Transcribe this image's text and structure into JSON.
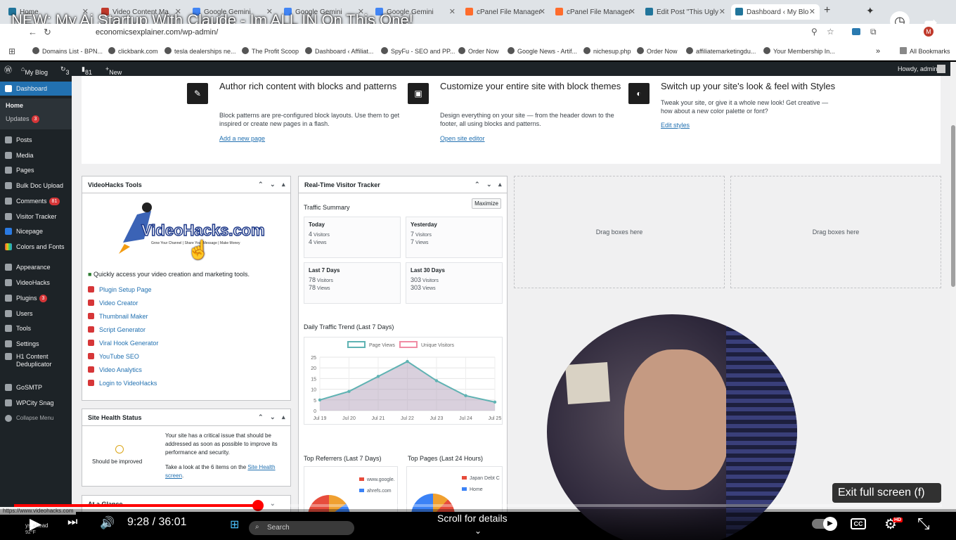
{
  "video": {
    "title": "NEW: My Ai Startup With Claude - Im ALL IN On This One!",
    "time_current": "9:28",
    "time_total": "36:01",
    "time_separator": " / ",
    "progress": 0.263,
    "scroll_hint": "Scroll for details",
    "exit_fullscreen": "Exit full screen (f)",
    "hd_badge": "HD",
    "cc_label": "CC",
    "ahead_text": "ys ahead",
    "temp_text": "92°F"
  },
  "browser": {
    "tabs": [
      "Home",
      "Video Content Ma",
      "Google Gemini",
      "Google Gemini",
      "Google Gemini",
      "cPanel File Manager",
      "cPanel File Manager",
      "Edit Post \"This Ugly",
      "Dashboard ‹ My Blo"
    ],
    "url": "economicsexplainer.com/wp-admin/",
    "bookmarks": [
      "Domains List - BPN...",
      "clickbank.com",
      "tesla dealerships ne...",
      "The Profit Scoop",
      "Dashboard ‹ Affiliat...",
      "SpyFu - SEO and PP...",
      "Order Now",
      "Google News - Artif...",
      "nichesup.php",
      "Order Now",
      "affiliatemarketingdu...",
      "Your Membership In..."
    ],
    "all_bookmarks": "All Bookmarks",
    "status_url": "https://www.videohacks.com"
  },
  "adminbar": {
    "site": "My Blog",
    "updates": "3",
    "comments": "81",
    "new": "New",
    "howdy": "Howdy, admin"
  },
  "sidebar": {
    "items": [
      {
        "label": "Dashboard"
      },
      {
        "label": "Home"
      },
      {
        "label": "Updates",
        "badge": "3"
      },
      {
        "label": "Posts"
      },
      {
        "label": "Media"
      },
      {
        "label": "Pages"
      },
      {
        "label": "Bulk Doc Upload"
      },
      {
        "label": "Comments",
        "badge": "81"
      },
      {
        "label": "Visitor Tracker"
      },
      {
        "label": "Nicepage"
      },
      {
        "label": "Colors and Fonts"
      },
      {
        "label": "Appearance"
      },
      {
        "label": "VideoHacks"
      },
      {
        "label": "Plugins",
        "badge": "3"
      },
      {
        "label": "Users"
      },
      {
        "label": "Tools"
      },
      {
        "label": "Settings"
      },
      {
        "label": "H1 Content"
      },
      {
        "label": "Deduplicator"
      },
      {
        "label": "GoSMTP"
      },
      {
        "label": "WPCity Snag"
      },
      {
        "label": "Collapse Menu"
      }
    ]
  },
  "welcome": {
    "cols": [
      {
        "title": "Author rich content with blocks and patterns",
        "desc": "Block patterns are pre-configured block layouts. Use them to get inspired or create new pages in a flash.",
        "link": "Add a new page"
      },
      {
        "title": "Customize your entire site with block themes",
        "desc": "Design everything on your site — from the header down to the footer, all using blocks and patterns.",
        "link": "Open site editor"
      },
      {
        "title": "Switch up your site's look & feel with Styles",
        "desc": "Tweak your site, or give it a whole new look! Get creative — how about a new color palette or font?",
        "link": "Edit styles"
      }
    ]
  },
  "videohacks": {
    "title": "VideoHacks Tools",
    "logo_text": "VideoHacks.com",
    "tagline": "Grow Your Channel | Share Your Message | Make Money",
    "intro": "Quickly access your video creation and marketing tools.",
    "tools": [
      "Plugin Setup Page",
      "Video Creator",
      "Thumbnail Maker",
      "Script Generator",
      "Viral Hook Generator",
      "YouTube SEO",
      "Video Analytics",
      "Login to VideoHacks"
    ]
  },
  "health": {
    "title": "Site Health Status",
    "status": "Should be improved",
    "msg": "Your site has a critical issue that should be addressed as soon as possible to improve its performance and security.",
    "items_pre": "Take a look at the ",
    "items_count": "6 items",
    "items_mid": " on the ",
    "link": "Site Health screen",
    "items_post": "."
  },
  "glance": {
    "title": "At a Glance"
  },
  "tracker": {
    "title": "Real-Time Visitor Tracker",
    "summary": "Traffic Summary",
    "maximize": "Maximize",
    "visitors_label": "Visitors",
    "views_label": "Views",
    "stats": [
      {
        "label": "Today",
        "visitors": "4",
        "views": "4"
      },
      {
        "label": "Yesterday",
        "visitors": "7",
        "views": "7"
      },
      {
        "label": "Last 7 Days",
        "visitors": "78",
        "views": "78"
      },
      {
        "label": "Last 30 Days",
        "visitors": "303",
        "views": "303"
      }
    ],
    "trend_title": "Daily Traffic Trend (Last 7 Days)",
    "referrers_title": "Top Referrers (Last 7 Days)",
    "pages_title": "Top Pages (Last 24 Hours)",
    "referrers": [
      "www.google.",
      "ahrefs.com"
    ],
    "pages": [
      "Japan Debt C",
      "Home"
    ]
  },
  "dropzones": [
    "Drag boxes here",
    "Drag boxes here"
  ],
  "taskbar": {
    "search": "Search"
  },
  "chart_data": {
    "type": "line",
    "categories": [
      "Jul 19",
      "Jul 20",
      "Jul 21",
      "Jul 22",
      "Jul 23",
      "Jul 24",
      "Jul 25"
    ],
    "series": [
      {
        "name": "Page Views",
        "values": [
          5,
          9,
          16,
          23,
          14,
          7,
          4
        ],
        "color": "#5fb3b3"
      },
      {
        "name": "Unique Visitors",
        "values": [
          5,
          9,
          16,
          23,
          14,
          7,
          4
        ],
        "color": "#f08ca4"
      }
    ],
    "yticks": [
      0,
      5,
      10,
      15,
      20,
      25
    ],
    "ylim": [
      0,
      25
    ]
  }
}
